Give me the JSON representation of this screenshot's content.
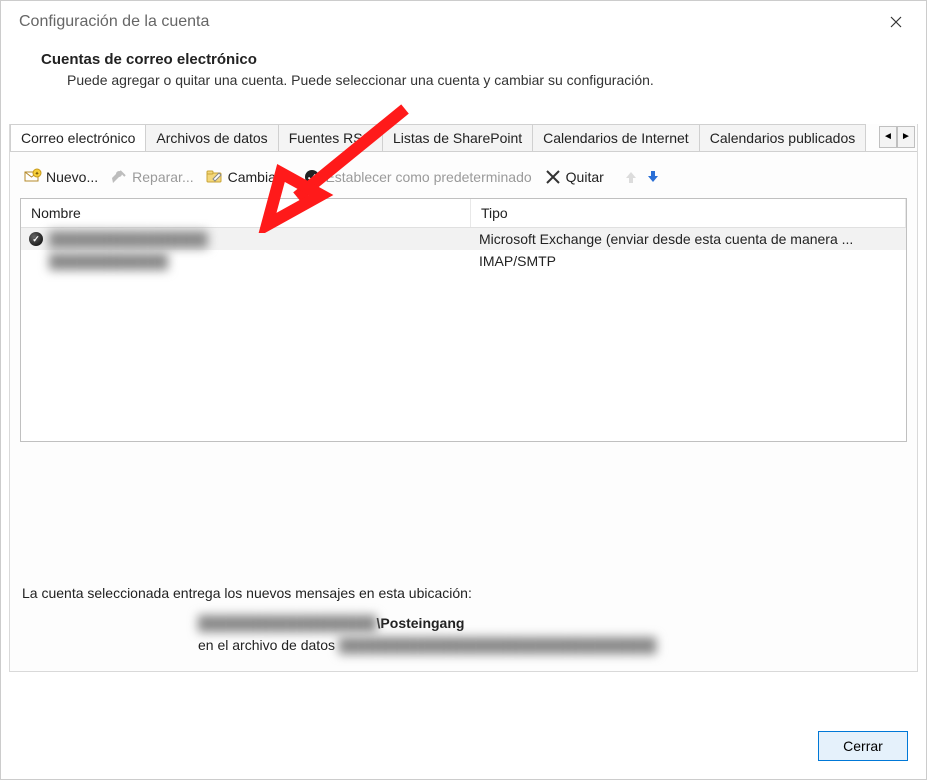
{
  "window": {
    "title": "Configuración de la cuenta"
  },
  "header": {
    "title": "Cuentas de correo electrónico",
    "description": "Puede agregar o quitar una cuenta. Puede seleccionar una cuenta y cambiar su configuración."
  },
  "tabs": {
    "items": [
      "Correo electrónico",
      "Archivos de datos",
      "Fuentes RSS",
      "Listas de SharePoint",
      "Calendarios de Internet",
      "Calendarios publicados"
    ],
    "left": "◄",
    "right": "►"
  },
  "toolbar": {
    "new": "Nuevo...",
    "repair": "Reparar...",
    "change": "Cambiar...",
    "set_default": "Establecer como predeterminado",
    "remove": "Quitar"
  },
  "table": {
    "headers": {
      "name": "Nombre",
      "type": "Tipo"
    },
    "rows": [
      {
        "name": "████████████████",
        "type": "Microsoft Exchange (enviar desde esta cuenta de manera ...",
        "default": true
      },
      {
        "name": "████████████",
        "type": "IMAP/SMTP",
        "default": false
      }
    ]
  },
  "location": {
    "intro": "La cuenta seleccionada entrega los nuevos mensajes en esta ubicación:",
    "path_blur": "██████████████████",
    "path_suffix": "\\Posteingang",
    "datafile_label": "en el archivo de datos",
    "datafile_blur": "████████████████████████████████"
  },
  "footer": {
    "close": "Cerrar"
  }
}
